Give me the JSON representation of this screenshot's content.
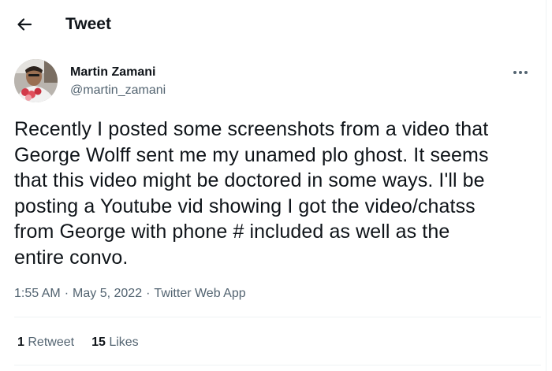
{
  "header": {
    "title": "Tweet",
    "back_icon": "arrow-left-icon"
  },
  "author": {
    "name": "Martin Zamani",
    "handle": "@martin_zamani"
  },
  "more_icon": "more-dots-icon",
  "tweet": {
    "text": "Recently I posted some screenshots from a video that\nGeorge Wolff sent me my unamed plo ghost. It seems\nthat this video might be doctored in some ways. I'll be\nposting a  Youtube  vid showing I got the video/chatss\nfrom George with phone # included as well as the\nentire convo."
  },
  "meta": {
    "time": "1:55 AM",
    "separator": "·",
    "date": "May 5, 2022",
    "source": "Twitter Web App"
  },
  "stats": {
    "retweets": {
      "count": "1",
      "label": "Retweet"
    },
    "likes": {
      "count": "15",
      "label": "Likes"
    }
  },
  "colors": {
    "text": "#0f1419",
    "secondary": "#536471",
    "divider": "#eff3f4"
  }
}
